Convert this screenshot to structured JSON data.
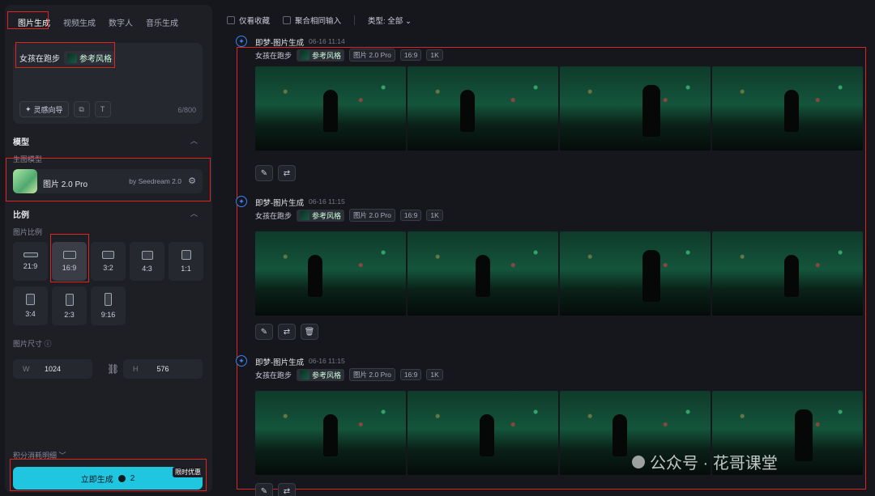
{
  "tabs": [
    "图片生成",
    "视频生成",
    "数字人",
    "音乐生成"
  ],
  "prompt": {
    "text": "女孩在跑步",
    "ref_label": "参考风格",
    "inspire_label": "灵感向导",
    "counter": "6/800"
  },
  "model": {
    "section_title": "模型",
    "sub_label": "生图模型",
    "name": "图片 2.0 Pro",
    "by": "by Seedream 2.0"
  },
  "ratio": {
    "section_title": "比例",
    "sub_label": "图片比例",
    "options": [
      "21:9",
      "16:9",
      "3:2",
      "4:3",
      "1:1",
      "3:4",
      "2:3",
      "9:16"
    ],
    "selected": "16:9"
  },
  "size": {
    "label": "图片尺寸",
    "w_label": "W",
    "w_value": "1024",
    "h_label": "H",
    "h_value": "576"
  },
  "points_label": "积分消耗明细",
  "generate": {
    "label": "立即生成",
    "cost": "2",
    "promo": "限时优惠"
  },
  "topbar": {
    "fav": "仅看收藏",
    "merge": "聚合相同输入",
    "type": "类型: 全部"
  },
  "groups": [
    {
      "title": "即梦-图片生成",
      "time": "06-16  11:14",
      "prompt": "女孩在跑步",
      "ref": "参考风格",
      "tags": [
        "图片 2.0 Pro",
        "16:9",
        "1K"
      ]
    },
    {
      "title": "即梦-图片生成",
      "time": "06-16  11:15",
      "prompt": "女孩在跑步",
      "ref": "参考风格",
      "tags": [
        "图片 2.0 Pro",
        "16:9",
        "1K"
      ]
    },
    {
      "title": "即梦-图片生成",
      "time": "06-16  11:15",
      "prompt": "女孩在跑步",
      "ref": "参考风格",
      "tags": [
        "图片 2.0 Pro",
        "16:9",
        "1K"
      ]
    }
  ],
  "watermark": "公众号 · 花哥课堂"
}
